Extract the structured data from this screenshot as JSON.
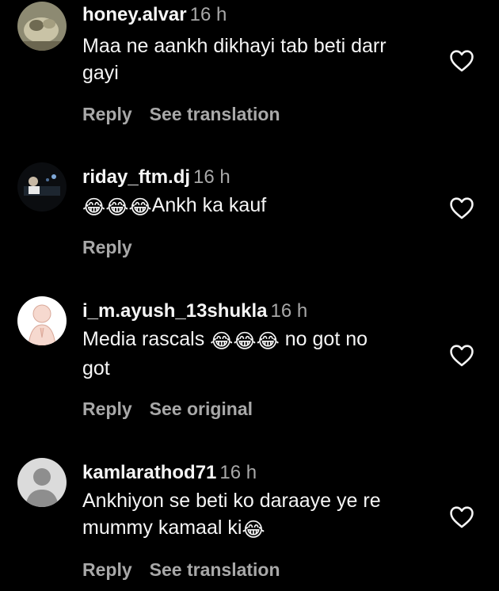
{
  "comments": [
    {
      "username": "honey.alvar",
      "time": "16 h",
      "text_line1": "Maa ne aankh dikhayi tab beti darr",
      "text_line2": "gayi",
      "reply_label": "Reply",
      "secondary_action": "See translation",
      "avatar_icon": "cat-photo-avatar",
      "heart_icon": "heart-outline-icon"
    },
    {
      "username": "riday_ftm.dj",
      "time": "16 h",
      "text_prefix_emojis": "😂😂😂",
      "text": "Ankh ka kauf",
      "reply_label": "Reply",
      "avatar_icon": "dj-photo-avatar",
      "heart_icon": "heart-outline-icon"
    },
    {
      "username": "i_m.ayush_13shukla",
      "time": "16 h",
      "text_line1_a": "Media rascals ",
      "text_line1_emojis": "😂😂😂",
      "text_line1_b": " no got no",
      "text_line2": "got",
      "reply_label": "Reply",
      "secondary_action": "See original",
      "avatar_icon": "praying-monk-avatar",
      "heart_icon": "heart-outline-icon"
    },
    {
      "username": "kamlarathod71",
      "time": "16 h",
      "text_line1": "Ankhiyon se beti ko daraaye ye re",
      "text_line2_a": "mummy kamaal ki",
      "text_line2_emoji": "😂",
      "reply_label": "Reply",
      "secondary_action": "See translation",
      "avatar_icon": "default-user-avatar",
      "heart_icon": "heart-outline-icon"
    }
  ],
  "colors": {
    "background": "#000000",
    "primary_text": "#f5f5f5",
    "secondary_text": "#a8a8a8"
  }
}
